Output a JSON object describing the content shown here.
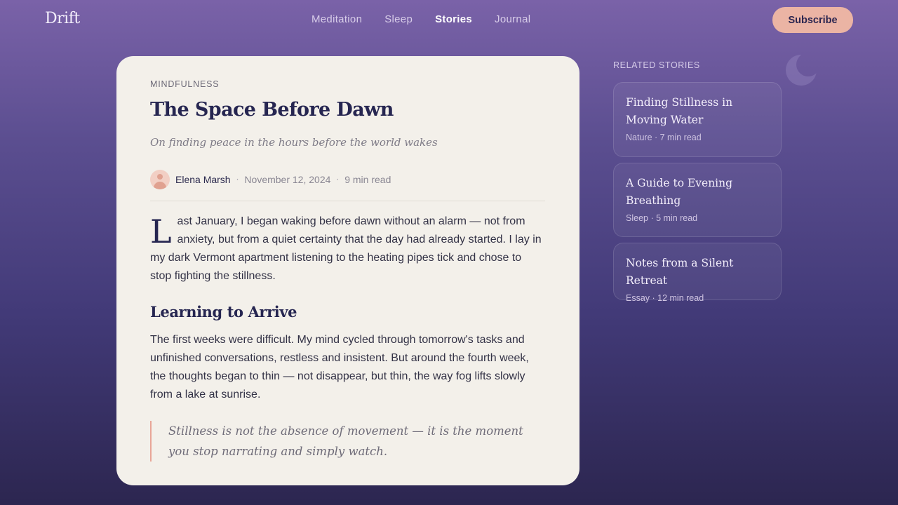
{
  "brand": "Drift",
  "nav": {
    "items": [
      {
        "label": "Meditation",
        "active": false
      },
      {
        "label": "Sleep",
        "active": false
      },
      {
        "label": "Stories",
        "active": true
      },
      {
        "label": "Journal",
        "active": false
      }
    ],
    "subscribe_label": "Subscribe"
  },
  "article": {
    "category": "MINDFULNESS",
    "title": "The Space Before Dawn",
    "subtitle": "On finding peace in the hours before the world wakes",
    "author": "Elena Marsh",
    "date": "November 12, 2024",
    "read_time": "9 min read",
    "separator": "·",
    "dropcap": "L",
    "para1": "ast January, I began waking before dawn without an alarm — not from anxiety, but from a quiet certainty that the day had already started. I lay in my dark Vermont apartment listening to the heating pipes tick and chose to stop fighting the stillness.",
    "heading": "Learning to Arrive",
    "para2": "The first weeks were difficult. My mind cycled through tomorrow's tasks and unfinished conversations, restless and insistent. But around the fourth week, the thoughts began to thin — not disappear, but thin, the way fog lifts slowly from a lake at sunrise.",
    "quote": "Stillness is not the absence of movement — it is the moment you stop narrating and simply watch."
  },
  "sidebar": {
    "heading": "RELATED STORIES",
    "stories": [
      {
        "title": "Finding Stillness in Moving Water",
        "meta": "Nature · 7 min read"
      },
      {
        "title": "A Guide to Evening Breathing",
        "meta": "Sleep · 5 min read"
      },
      {
        "title": "Notes from a Silent Retreat",
        "meta": "Essay · 12 min read"
      }
    ]
  },
  "icons": {
    "moon": "moon-icon",
    "avatar": "user-avatar-icon"
  },
  "colors": {
    "accent": "#ebb4a4",
    "background_top": "#7a62a8",
    "background_bottom": "#2c2650",
    "card": "#f3f0ea",
    "ink": "#262651"
  }
}
